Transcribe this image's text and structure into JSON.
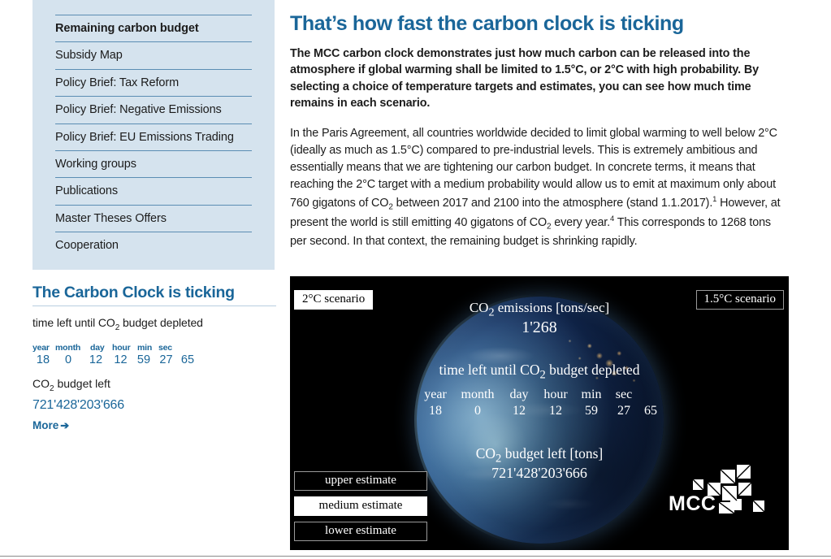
{
  "sidebar": {
    "items": [
      {
        "label": "Remaining carbon budget",
        "active": true
      },
      {
        "label": "Subsidy Map",
        "active": false
      },
      {
        "label": "Policy Brief: Tax Reform",
        "active": false
      },
      {
        "label": "Policy Brief: Negative Emissions",
        "active": false
      },
      {
        "label": "Policy Brief: EU Emissions Trading",
        "active": false
      },
      {
        "label": "Working groups",
        "active": false
      },
      {
        "label": "Publications",
        "active": false
      },
      {
        "label": "Master Theses Offers",
        "active": false
      },
      {
        "label": "Cooperation",
        "active": false
      }
    ],
    "background_color": "#d5e3ee",
    "divider_color": "#5b8db3"
  },
  "clock_widget": {
    "title": "The Carbon Clock is ticking",
    "subtitle_prefix": "time left until CO",
    "subtitle_sub": "2",
    "subtitle_suffix": " budget depleted",
    "unit_labels": [
      "year",
      "month",
      "day",
      "hour",
      "min",
      "sec"
    ],
    "values": [
      "18",
      "0",
      "12",
      "12",
      "59",
      "27",
      "65"
    ],
    "budget_label_prefix": "CO",
    "budget_label_sub": "2",
    "budget_label_suffix": " budget left",
    "budget_value": "721'428'203'666",
    "more_label": "More",
    "more_arrow": "➔",
    "accent_color": "#1a6699"
  },
  "main": {
    "heading": "That’s how fast the carbon clock is ticking",
    "intro_paragraph": "The MCC carbon clock demonstrates just how much carbon can be released into the atmosphere if global warming shall be limited to 1.5°C, or 2°C with high probability. By selecting a choice of temperature targets and estimates, you can see how much time remains in each scenario.",
    "body_paragraph": {
      "part1": "In the Paris Agreement, all countries worldwide decided to limit global warming to well below 2°C (ideally as much as 1.5°C) compared to pre-industrial levels. This is extremely ambitious and essentially means that we are tightening our carbon budget. In concrete terms, it means that reaching the 2°C target with a medium probability would allow us to emit at maximum only about 760 gigatons of CO",
      "sub1": "2",
      "part2": " between 2017 and 2100 into the atmosphere (stand 1.1.2017).",
      "sup1": "1",
      "part3": " However, at present the world is still emitting 40 gigatons of CO",
      "sub2": "2",
      "part4": " every year.",
      "sup2": "4",
      "part5": " This corresponds to 1268 tons per second. In that context, the remaining budget is shrinking rapidly."
    },
    "heading_color": "#1a6699"
  },
  "clock_panel": {
    "background_color": "#000000",
    "scenario_buttons": [
      {
        "label": "2°C scenario",
        "active": true
      },
      {
        "label": "1.5°C scenario",
        "active": false
      }
    ],
    "estimate_buttons": [
      {
        "label": "upper estimate",
        "active": false
      },
      {
        "label": "medium estimate",
        "active": true
      },
      {
        "label": "lower estimate",
        "active": false
      }
    ],
    "emissions_label_prefix": "CO",
    "emissions_label_sub": "2",
    "emissions_label_suffix": " emissions [tons/sec]",
    "emissions_value": "1'268",
    "timeleft_prefix": "time left until CO",
    "timeleft_sub": "2",
    "timeleft_suffix": " budget depleted",
    "unit_labels": [
      "year",
      "month",
      "day",
      "hour",
      "min",
      "sec",
      ""
    ],
    "values": [
      "18",
      "0",
      "12",
      "12",
      "59",
      "27",
      "65"
    ],
    "budget_label_prefix": "CO",
    "budget_label_sub": "2",
    "budget_label_suffix": " budget left [tons]",
    "budget_value": "721'428'203'666",
    "logo_text": "MCC"
  }
}
